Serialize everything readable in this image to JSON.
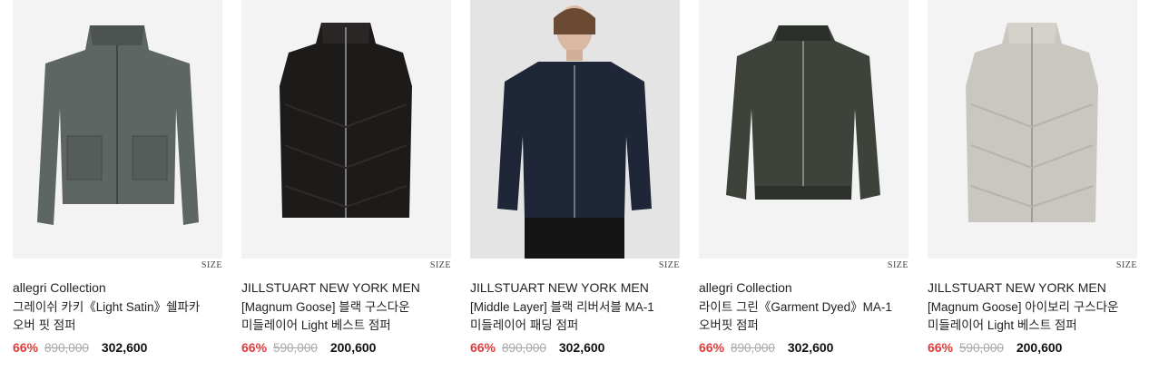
{
  "products": [
    {
      "brand": "allegri Collection",
      "name": "그레이쉬 카키《Light Satin》쉘파카 오버 핏 점퍼",
      "discount": "66%",
      "original_price": "890,000",
      "sale_price": "302,600",
      "size_label": "SIZE",
      "image_bg": "#f3f3f3",
      "garment_color": "#5e6663"
    },
    {
      "brand": "JILLSTUART NEW YORK MEN",
      "name": "[Magnum Goose] 블랙 구스다운 미들레이어 Light 베스트 점퍼",
      "discount": "66%",
      "original_price": "590,000",
      "sale_price": "200,600",
      "size_label": "SIZE",
      "image_bg": "#f3f3f3",
      "garment_color": "#1d1a1a"
    },
    {
      "brand": "JILLSTUART NEW YORK MEN",
      "name": "[Middle Layer] 블랙 리버서블 MA-1 미들레이어 패딩 점퍼",
      "discount": "66%",
      "original_price": "890,000",
      "sale_price": "302,600",
      "size_label": "SIZE",
      "image_bg": "#e4e4e4",
      "garment_color": "#1e2638"
    },
    {
      "brand": "allegri Collection",
      "name": "라이트 그린《Garment Dyed》MA-1 오버핏 점퍼",
      "discount": "66%",
      "original_price": "890,000",
      "sale_price": "302,600",
      "size_label": "SIZE",
      "image_bg": "#f3f3f3",
      "garment_color": "#3d433b"
    },
    {
      "brand": "JILLSTUART NEW YORK MEN",
      "name": "[Magnum Goose] 아이보리 구스다운 미들레이어 Light 베스트 점퍼",
      "discount": "66%",
      "original_price": "590,000",
      "sale_price": "200,600",
      "size_label": "SIZE",
      "image_bg": "#f3f3f3",
      "garment_color": "#c9c7c0"
    }
  ],
  "colors": {
    "discount": "#e03b3b",
    "strikethrough": "#aaaaaa"
  }
}
